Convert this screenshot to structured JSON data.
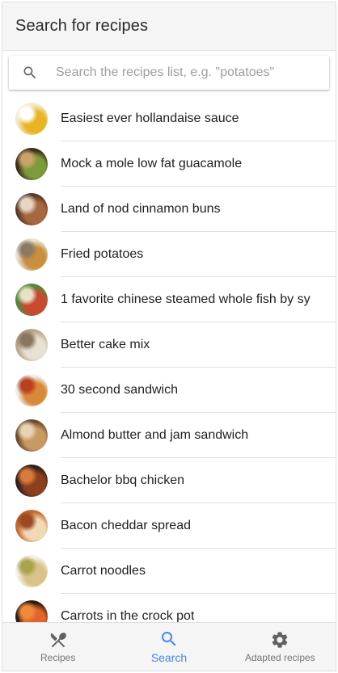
{
  "header": {
    "title": "Search for recipes"
  },
  "search": {
    "icon": "search-icon",
    "placeholder": "Search the recipes list, e.g. \"potatoes\"",
    "value": ""
  },
  "recipes": [
    {
      "name": "Easiest ever hollandaise sauce",
      "thumb_colors": [
        "#f3e9c9",
        "#e8b423",
        "#ffffff"
      ]
    },
    {
      "name": "Mock a mole low fat guacamole",
      "thumb_colors": [
        "#3b2a1a",
        "#7d9b3a",
        "#c9a36a"
      ]
    },
    {
      "name": "Land of nod cinnamon buns",
      "thumb_colors": [
        "#5a3a25",
        "#a6683f",
        "#e7d6c4"
      ]
    },
    {
      "name": "Fried potatoes",
      "thumb_colors": [
        "#e9e2d6",
        "#c98f3c",
        "#8a7a66"
      ]
    },
    {
      "name": "1 favorite chinese steamed whole fish by sy",
      "thumb_colors": [
        "#4f8a3c",
        "#c94a2e",
        "#e9e0c8"
      ]
    },
    {
      "name": "Better cake mix",
      "thumb_colors": [
        "#b9a58a",
        "#e8e0d2",
        "#8a7560"
      ]
    },
    {
      "name": "30 second sandwich",
      "thumb_colors": [
        "#f2f0ec",
        "#d9893a",
        "#b8401f"
      ]
    },
    {
      "name": "Almond butter and jam sandwich",
      "thumb_colors": [
        "#6e4a2c",
        "#c79a63",
        "#e7d3b3"
      ]
    },
    {
      "name": "Bachelor bbq chicken",
      "thumb_colors": [
        "#2b1f1a",
        "#8c3f1f",
        "#d97a3a"
      ]
    },
    {
      "name": "Bacon cheddar spread",
      "thumb_colors": [
        "#c76a2e",
        "#f0d9b5",
        "#9a4a22"
      ]
    },
    {
      "name": "Carrot noodles",
      "thumb_colors": [
        "#f4f1e6",
        "#d9c38a",
        "#a8a44a"
      ]
    },
    {
      "name": "Carrots in the crock pot",
      "thumb_colors": [
        "#2a1a12",
        "#e0652b",
        "#f08a3a"
      ]
    }
  ],
  "bottom_nav": {
    "items": [
      {
        "label": "Recipes",
        "icon": "fork-knife-icon",
        "active": false
      },
      {
        "label": "Search",
        "icon": "search-icon",
        "active": true
      },
      {
        "label": "Adapted recipes",
        "icon": "gear-icon",
        "active": false
      }
    ]
  },
  "colors": {
    "accent": "#4285f4",
    "inactive": "#757575",
    "header_bg": "#f5f5f5"
  }
}
